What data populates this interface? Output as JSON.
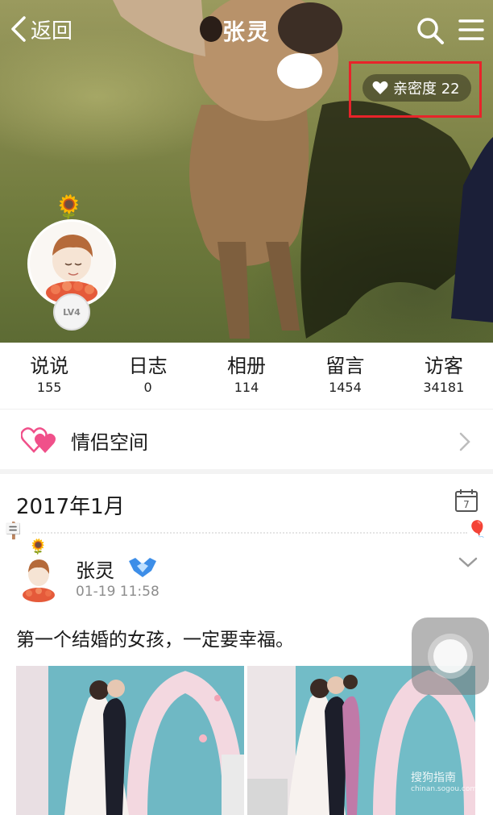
{
  "nav": {
    "back_label": "返回",
    "title": "张灵"
  },
  "intimacy": {
    "label": "亲密度 22"
  },
  "profile": {
    "level_badge": "LV4"
  },
  "stats": [
    {
      "label": "说说",
      "value": "155"
    },
    {
      "label": "日志",
      "value": "0"
    },
    {
      "label": "相册",
      "value": "114"
    },
    {
      "label": "留言",
      "value": "1454"
    },
    {
      "label": "访客",
      "value": "34181"
    }
  ],
  "couple_space": {
    "label": "情侣空间"
  },
  "feed": {
    "month": "2017年1月",
    "calendar_day": "7"
  },
  "post": {
    "author": "张灵",
    "time": "01-19 11:58",
    "text": "第一个结婚的女孩，一定要幸福。"
  },
  "watermark": {
    "brand": "搜狗指南",
    "url": "chinan.sogou.com"
  },
  "colors": {
    "highlight_box": "#e8232a",
    "couple_heart": "#f0508a",
    "vip_badge": "#3d8ee8"
  },
  "icons": [
    "back-chevron-icon",
    "search-icon",
    "menu-icon",
    "heart-icon",
    "couple-hearts-icon",
    "chevron-right-icon",
    "calendar-icon",
    "vip-badge-icon",
    "chevron-down-icon"
  ]
}
